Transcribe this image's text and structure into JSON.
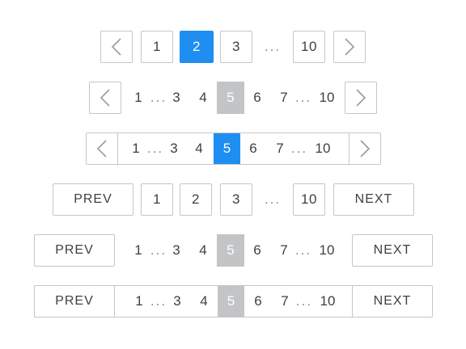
{
  "row1": {
    "pages": [
      "1",
      "2",
      "3",
      "10"
    ],
    "ellipsis": "...",
    "current": "2"
  },
  "row2": {
    "items": [
      "1",
      "...",
      "3",
      "4",
      "5",
      "6",
      "7",
      "...",
      "10"
    ],
    "current": "5"
  },
  "row3": {
    "items": [
      "1",
      "...",
      "3",
      "4",
      "5",
      "6",
      "7",
      "...",
      "10"
    ],
    "current": "5"
  },
  "row4": {
    "prev": "PREV",
    "next": "NEXT",
    "pages": [
      "1",
      "2",
      "3",
      "10"
    ],
    "ellipsis": "..."
  },
  "row5": {
    "prev": "PREV",
    "next": "NEXT",
    "items": [
      "1",
      "...",
      "3",
      "4",
      "5",
      "6",
      "7",
      "...",
      "10"
    ],
    "current": "5"
  },
  "row6": {
    "prev": "PREV",
    "next": "NEXT",
    "items": [
      "1",
      "...",
      "3",
      "4",
      "5",
      "6",
      "7",
      "...",
      "10"
    ],
    "current": "5"
  },
  "icons": {
    "prev": "chevron-left-icon",
    "next": "chevron-right-icon"
  },
  "colors": {
    "active_blue": "#1e8ef0",
    "active_gray": "#c3c4c6",
    "border": "#c6c6c6"
  }
}
